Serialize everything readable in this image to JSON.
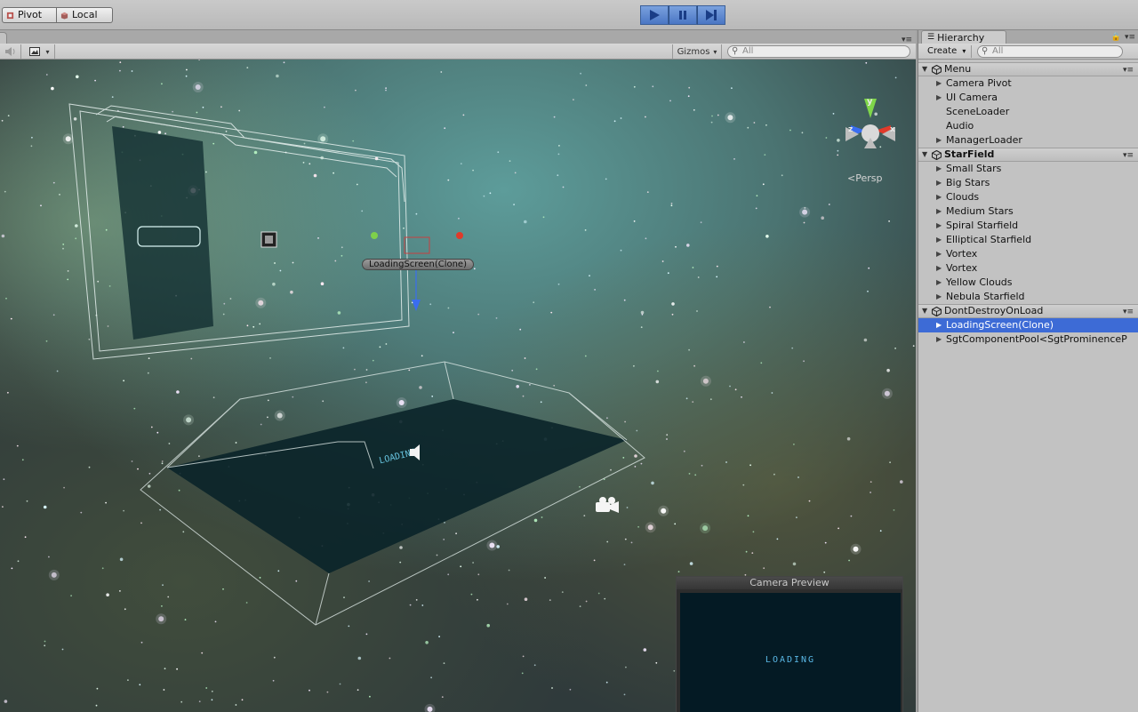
{
  "toolbar": {
    "pivot_label": "Pivot",
    "local_label": "Local",
    "play_icon": "play-icon",
    "pause_icon": "pause-icon",
    "step_icon": "step-icon",
    "accent_color": "#4a76c4"
  },
  "scene": {
    "gizmos_label": "Gizmos",
    "search_placeholder": "All",
    "persp_label": "Persp",
    "axis_y": "y",
    "axis_x": "x",
    "axis_z": "z",
    "object_label": "LoadingScreen(Clone)",
    "camera_preview": {
      "title": "Camera Preview",
      "content_text": "LOADING"
    }
  },
  "hierarchy": {
    "tab_label": "Hierarchy",
    "create_label": "Create",
    "search_placeholder": "All",
    "selection_color": "#3d6bd6",
    "scenes": [
      {
        "name": "Menu",
        "bold": false,
        "items": [
          {
            "label": "Camera Pivot",
            "expandable": true,
            "selected": false
          },
          {
            "label": "UI Camera",
            "expandable": true,
            "selected": false
          },
          {
            "label": "SceneLoader",
            "expandable": false,
            "selected": false
          },
          {
            "label": "Audio",
            "expandable": false,
            "selected": false
          },
          {
            "label": "ManagerLoader",
            "expandable": true,
            "selected": false
          }
        ]
      },
      {
        "name": "StarField",
        "bold": true,
        "items": [
          {
            "label": "Small Stars",
            "expandable": true,
            "selected": false
          },
          {
            "label": "Big Stars",
            "expandable": true,
            "selected": false
          },
          {
            "label": "Clouds",
            "expandable": true,
            "selected": false
          },
          {
            "label": "Medium Stars",
            "expandable": true,
            "selected": false
          },
          {
            "label": "Spiral Starfield",
            "expandable": true,
            "selected": false
          },
          {
            "label": "Elliptical Starfield",
            "expandable": true,
            "selected": false
          },
          {
            "label": "Vortex",
            "expandable": true,
            "selected": false
          },
          {
            "label": "Vortex",
            "expandable": true,
            "selected": false
          },
          {
            "label": "Yellow Clouds",
            "expandable": true,
            "selected": false
          },
          {
            "label": "Nebula Starfield",
            "expandable": true,
            "selected": false
          }
        ]
      },
      {
        "name": "DontDestroyOnLoad",
        "bold": false,
        "items": [
          {
            "label": "LoadingScreen(Clone)",
            "expandable": true,
            "selected": true
          },
          {
            "label": "SgtComponentPool<SgtProminenceP",
            "expandable": true,
            "selected": false
          }
        ]
      }
    ]
  }
}
